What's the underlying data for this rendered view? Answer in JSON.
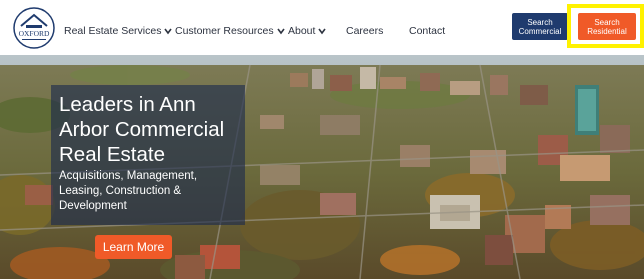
{
  "logo": {
    "text": "OXFORD",
    "icon": "house-roof-logo-icon"
  },
  "nav": {
    "items": [
      {
        "label": "Real Estate Services",
        "has_dropdown": true
      },
      {
        "label": "Customer Resources",
        "has_dropdown": true
      },
      {
        "label": "About",
        "has_dropdown": true
      },
      {
        "label": "Careers",
        "has_dropdown": false
      },
      {
        "label": "Contact",
        "has_dropdown": false
      }
    ]
  },
  "actions": {
    "commercial_line1": "Search",
    "commercial_line2": "Commercial",
    "residential_line1": "Search",
    "residential_line2": "Residential"
  },
  "hero": {
    "title": "Leaders in Ann Arbor Commercial Real Estate",
    "subtitle": "Acquisitions, Management, Leasing, Construction & Development",
    "cta": "Learn More"
  },
  "colors": {
    "brand_navy": "#1f3b6e",
    "accent_orange": "#f05a28",
    "highlight_yellow": "#fff200"
  }
}
